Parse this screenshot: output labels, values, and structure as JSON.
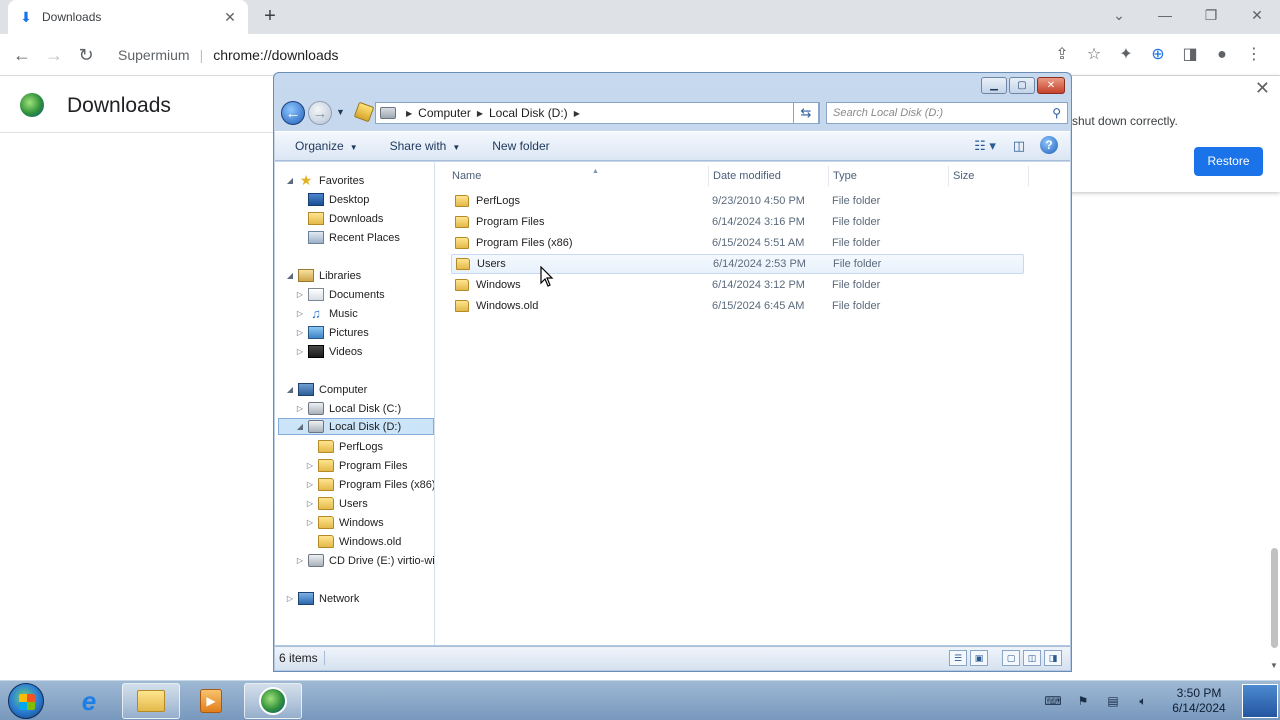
{
  "browser": {
    "tab_title": "Downloads",
    "new_tab": "+",
    "omnibox_origin": "Supermium",
    "omnibox_path": "chrome://downloads",
    "window_controls": {
      "chevron": "⌄",
      "min": "—",
      "restore": "❐",
      "close": "✕"
    }
  },
  "downloads_page": {
    "title": "Downloads",
    "restore_message": "shut down correctly.",
    "restore_button": "Restore",
    "close_glyph": "✕"
  },
  "explorer": {
    "address": {
      "computer": "Computer",
      "drive": "Local Disk (D:)"
    },
    "search_placeholder": "Search Local Disk (D:)",
    "commands": {
      "organize": "Organize",
      "share_with": "Share with",
      "new_folder": "New folder"
    },
    "nav": {
      "favorites": {
        "label": "Favorites",
        "items": [
          "Desktop",
          "Downloads",
          "Recent Places"
        ]
      },
      "libraries": {
        "label": "Libraries",
        "items": [
          "Documents",
          "Music",
          "Pictures",
          "Videos"
        ]
      },
      "computer": {
        "label": "Computer",
        "drives": [
          "Local Disk (C:)",
          "Local Disk (D:)"
        ],
        "d_children": [
          "PerfLogs",
          "Program Files",
          "Program Files (x86)",
          "Users",
          "Windows",
          "Windows.old"
        ],
        "cd_drive": "CD Drive (E:) virtio-win"
      },
      "network": "Network"
    },
    "columns": {
      "name": "Name",
      "date": "Date modified",
      "type": "Type",
      "size": "Size"
    },
    "files": [
      {
        "name": "PerfLogs",
        "date": "9/23/2010 4:50 PM",
        "type": "File folder"
      },
      {
        "name": "Program Files",
        "date": "6/14/2024 3:16 PM",
        "type": "File folder"
      },
      {
        "name": "Program Files (x86)",
        "date": "6/15/2024 5:51 AM",
        "type": "File folder"
      },
      {
        "name": "Users",
        "date": "6/14/2024 2:53 PM",
        "type": "File folder"
      },
      {
        "name": "Windows",
        "date": "6/14/2024 3:12 PM",
        "type": "File folder"
      },
      {
        "name": "Windows.old",
        "date": "6/15/2024 6:45 AM",
        "type": "File folder"
      }
    ],
    "status_count": "6 items"
  },
  "taskbar": {
    "time": "3:50 PM",
    "date": "6/14/2024"
  }
}
